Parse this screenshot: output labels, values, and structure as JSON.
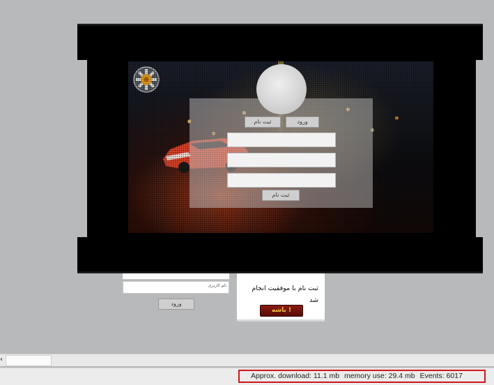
{
  "login_panel": {
    "tab_login": "ورود",
    "tab_register": "ثبت نام",
    "register_button": "ثبت نام"
  },
  "background_page": {
    "input_placeholder": "نام کاربری",
    "login_button": "ورود",
    "card_text": "ثبت نام با موفقیت انجام شد",
    "card_button": "باشه !"
  },
  "status": {
    "download": "Approx. download: 11.1 mb",
    "memory": "memory use: 29.4 mb",
    "events": "Events: 6017"
  },
  "colors": {
    "status_border": "#d1151b",
    "card_button": "#7a160f"
  }
}
